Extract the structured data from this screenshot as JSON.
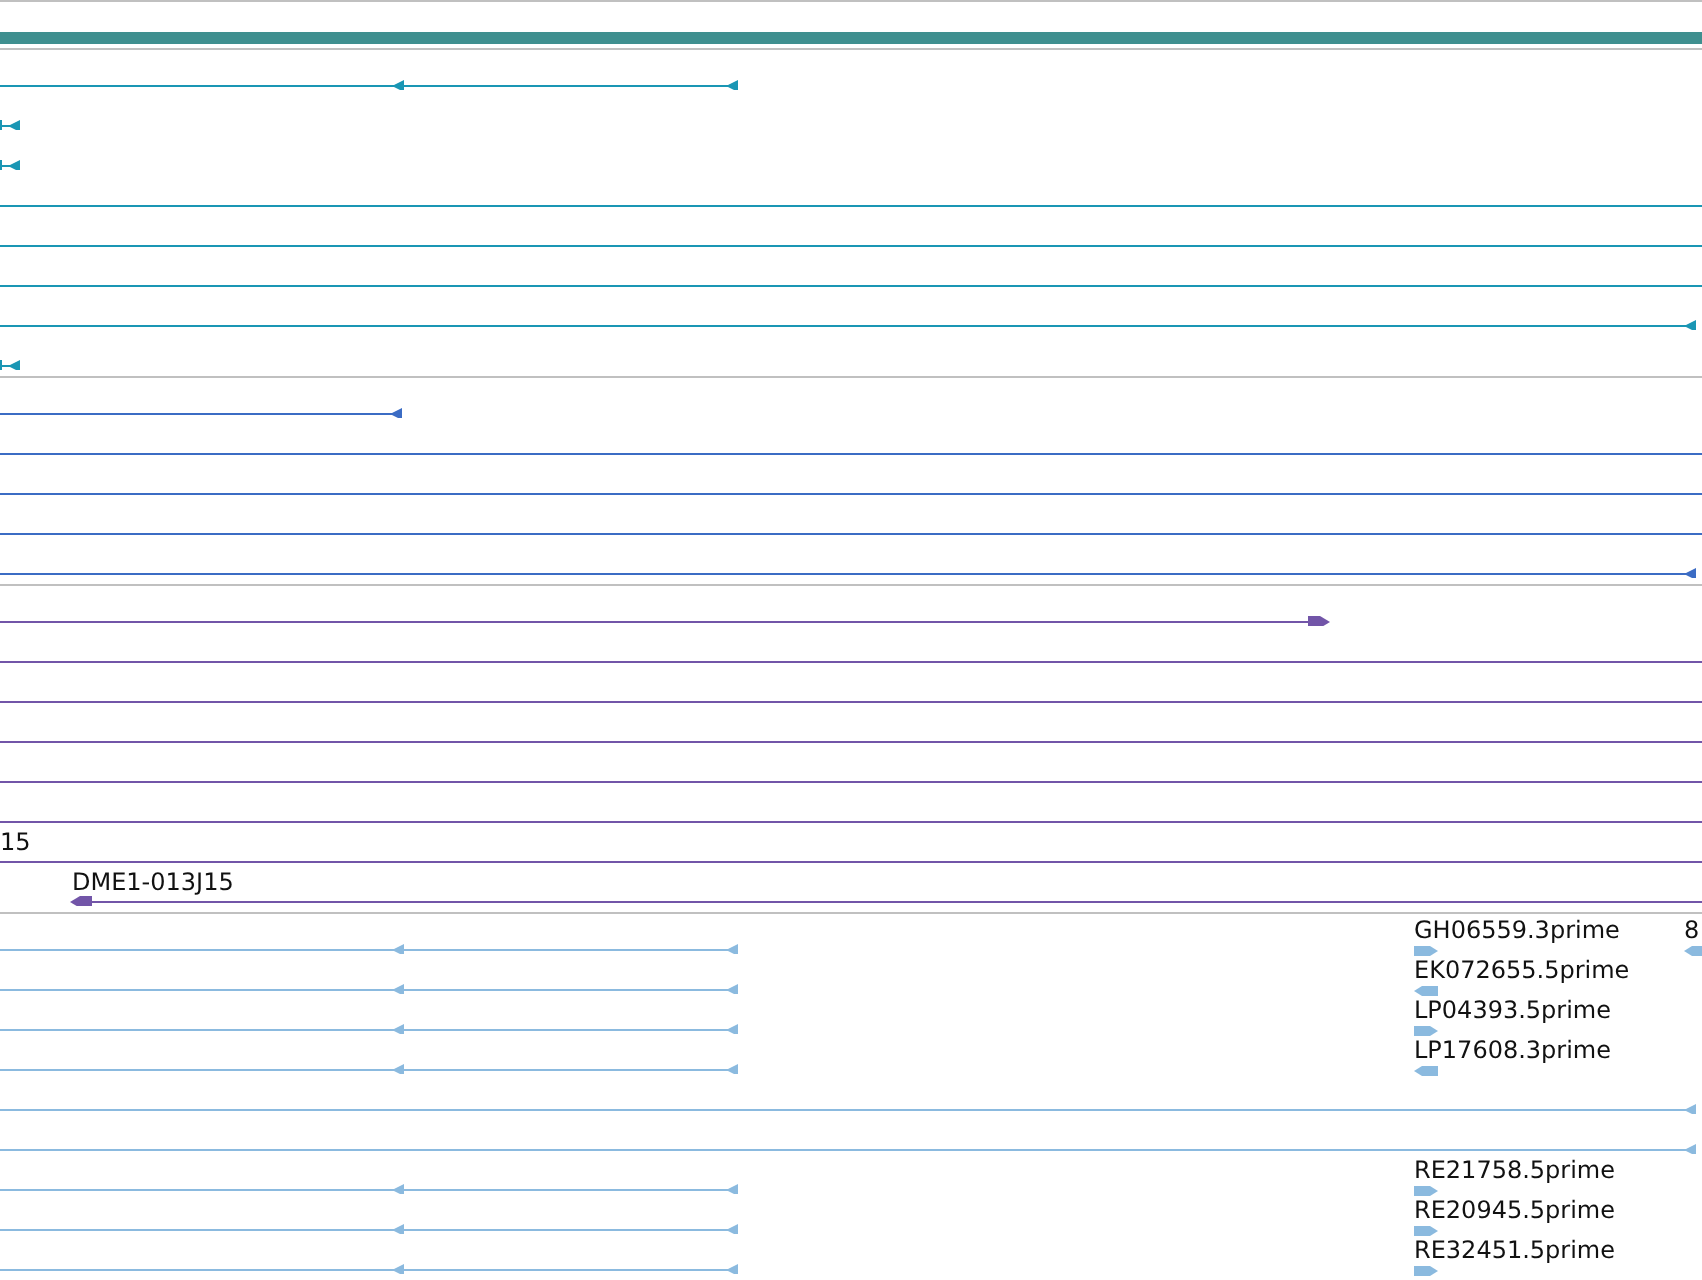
{
  "tracks": [
    {
      "color": "#1a96b4",
      "rows": [
        {
          "kind": "split"
        },
        {
          "kind": "stub"
        },
        {
          "kind": "stub"
        },
        {
          "kind": "plain"
        },
        {
          "kind": "plain"
        },
        {
          "kind": "plain"
        },
        {
          "kind": "arrow_end"
        },
        {
          "kind": "stub"
        }
      ]
    },
    {
      "color": "#3b6cc4",
      "rows": [
        {
          "kind": "half"
        },
        {
          "kind": "plain"
        },
        {
          "kind": "plain"
        },
        {
          "kind": "plain"
        },
        {
          "kind": "arrow_end"
        }
      ]
    },
    {
      "color": "#7255a8",
      "rows": [
        {
          "kind": "forward"
        },
        {
          "kind": "plain"
        },
        {
          "kind": "plain"
        },
        {
          "kind": "plain"
        },
        {
          "kind": "plain"
        },
        {
          "kind": "plain"
        },
        {
          "kind": "plain",
          "labels": [
            {
              "text": "15"
            }
          ]
        },
        {
          "kind": "tail",
          "labels": [
            {
              "text": "DME1-013J15"
            }
          ]
        }
      ]
    },
    {
      "color": "#8bbadf",
      "rows": [
        {
          "kind": "split",
          "labels": [
            {
              "text": "GH06559.3prime",
              "forward": true
            },
            {
              "text": "8",
              "forward": false
            }
          ]
        },
        {
          "kind": "split",
          "labels": [
            {
              "text": "EK072655.5prime",
              "forward": false
            }
          ]
        },
        {
          "kind": "split",
          "labels": [
            {
              "text": "LP04393.5prime",
              "forward": true
            }
          ]
        },
        {
          "kind": "split",
          "labels": [
            {
              "text": "LP17608.3prime",
              "forward": false
            }
          ]
        },
        {
          "kind": "arrow_end"
        },
        {
          "kind": "arrow_end"
        },
        {
          "kind": "split",
          "labels": [
            {
              "text": "RE21758.5prime",
              "forward": true
            }
          ]
        },
        {
          "kind": "split",
          "labels": [
            {
              "text": "RE20945.5prime",
              "forward": true
            }
          ]
        },
        {
          "kind": "split",
          "labels": [
            {
              "text": "RE32451.5prime",
              "forward": true
            }
          ]
        }
      ]
    }
  ]
}
